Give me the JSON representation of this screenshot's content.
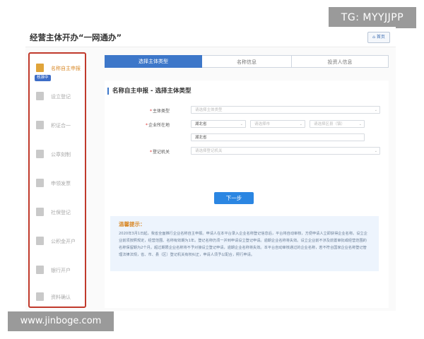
{
  "watermarks": {
    "top": "TG: MYYJJPP",
    "bottom": "www.jinboge.com"
  },
  "header": {
    "title": "经营主体开办“一网通办”",
    "home_label": "首页"
  },
  "sidebar": {
    "badge": "核准中",
    "items": [
      {
        "label": "名称自主申报",
        "icon": "name-report-icon"
      },
      {
        "label": "设立登记",
        "icon": "registration-icon"
      },
      {
        "label": "积证合一",
        "icon": "certificate-icon"
      },
      {
        "label": "公章刻制",
        "icon": "seal-icon"
      },
      {
        "label": "申领发票",
        "icon": "invoice-icon"
      },
      {
        "label": "社保登记",
        "icon": "social-security-icon"
      },
      {
        "label": "公积金开户",
        "icon": "housing-fund-icon"
      },
      {
        "label": "银行开户",
        "icon": "bank-icon"
      },
      {
        "label": "资料确认",
        "icon": "document-icon"
      }
    ]
  },
  "steps": [
    "选择主体类型",
    "名称信息",
    "投资人信息"
  ],
  "panel": {
    "title": "名称自主申报 - 选择主体类型"
  },
  "form": {
    "entity_type": {
      "label": "主体类型",
      "placeholder": "请选择主体类型"
    },
    "location": {
      "label": "企业所在地",
      "province": "湖北省",
      "city_placeholder": "请选择市",
      "district_placeholder": "请选择区县（镇）",
      "detail_value": "湖北省"
    },
    "authority": {
      "label": "登记机关",
      "placeholder": "请选择登记机关"
    }
  },
  "next_button": "下一步",
  "tips": {
    "title": "温馨提示：",
    "body": "2020年3月1日起，我省全面推行企业名称自主申报。申请人在本平台录入企业名称登记信息后，平台将自动审核，方便申请人立即获得企业名称。设立企业前须按照规定，经营范围、名称有效期为1年。登记名称仍须一并到申请设立登记申请。逾期企业名称将失效。设立企业前不涉及前置审批或经营范围的名称保留期为2个月。超过期限企业名称将不予对接设立登记申请，逾期企业名称将失效。本平台自动审核通过的企业名称，若不符合国家企业名称登记管理法律法规，省、市、县（区）登记机关有权纠正，申请人须予以配合，照行申请。"
  }
}
